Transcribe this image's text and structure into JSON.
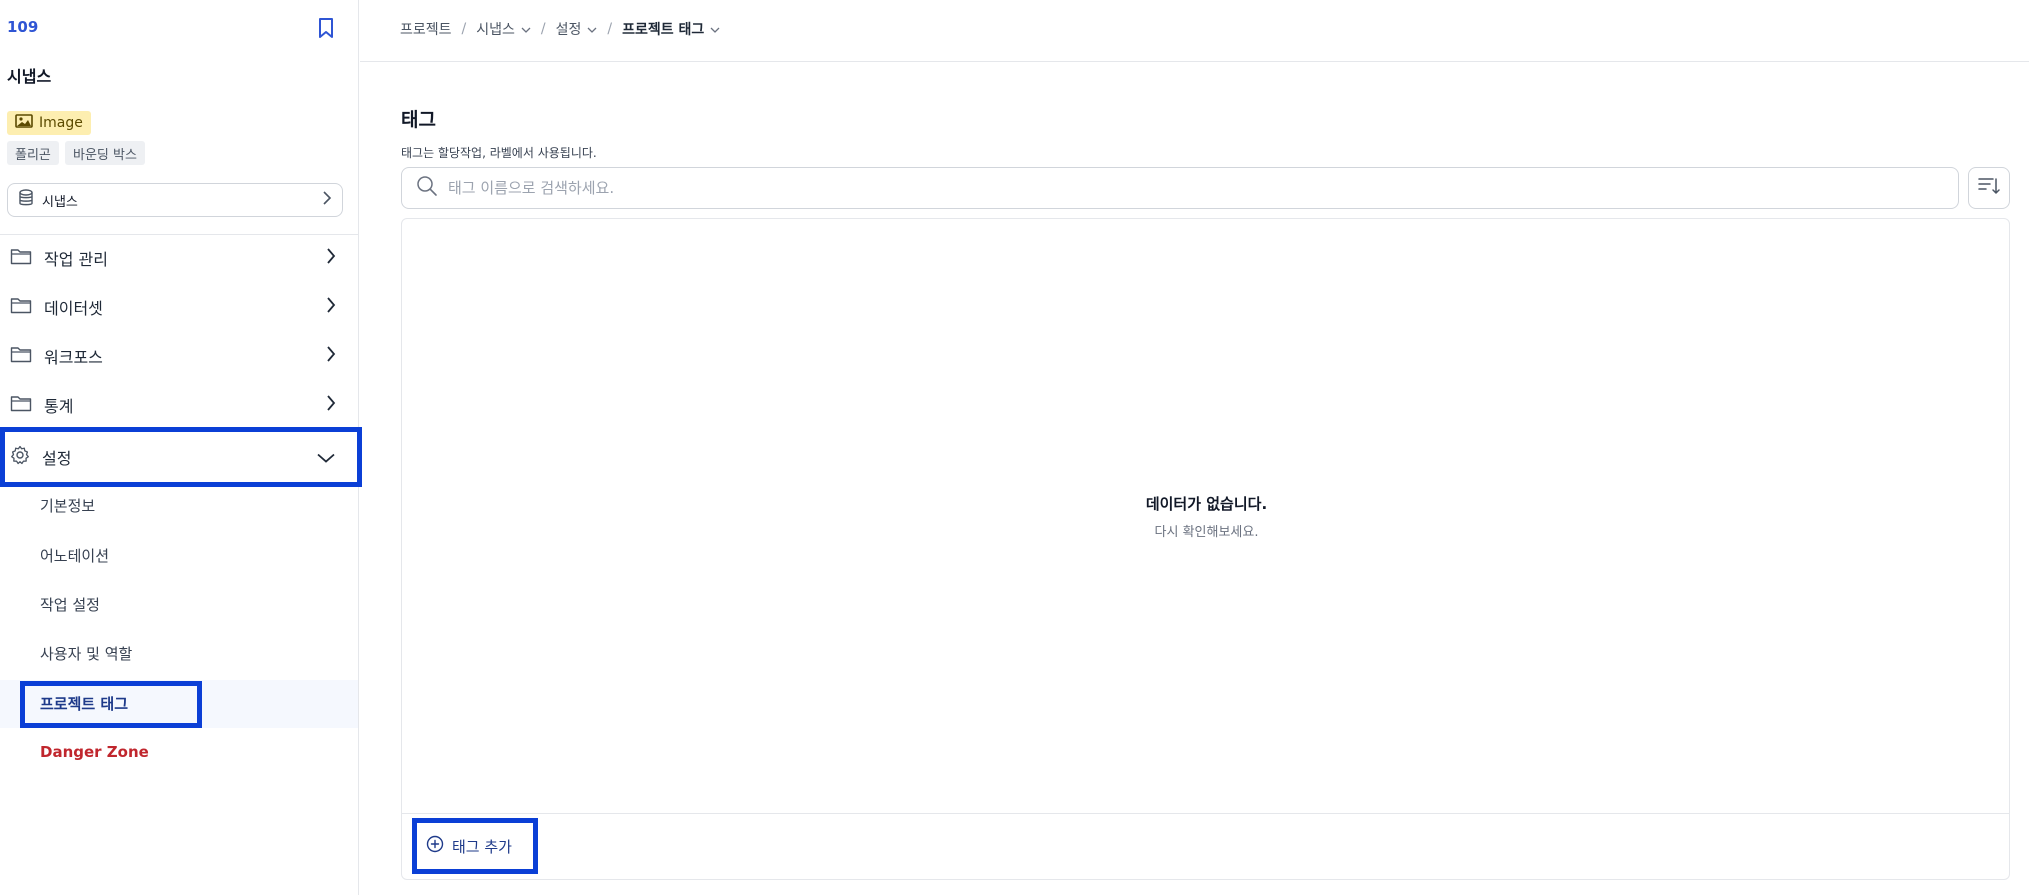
{
  "sidebar": {
    "project_id": "109",
    "project_name": "시냅스",
    "badge_image": "Image",
    "chips": [
      "폴리곤",
      "바운딩 박스"
    ],
    "dataset_label": "시냅스",
    "nav": [
      {
        "label": "작업 관리"
      },
      {
        "label": "데이터셋"
      },
      {
        "label": "워크포스"
      },
      {
        "label": "통계"
      },
      {
        "label": "설정"
      }
    ],
    "settings_sub": [
      {
        "label": "기본정보"
      },
      {
        "label": "어노테이션"
      },
      {
        "label": "작업 설정"
      },
      {
        "label": "사용자 및 역할"
      },
      {
        "label": "프로젝트 태그"
      },
      {
        "label": "Danger Zone"
      }
    ]
  },
  "breadcrumb": [
    "프로젝트",
    "시냅스",
    "설정",
    "프로젝트 태그"
  ],
  "main": {
    "title": "태그",
    "description": "태그는 할당작업, 라벨에서 사용됩니다.",
    "search_placeholder": "태그 이름으로 검색하세요.",
    "empty_title": "데이터가 없습니다.",
    "empty_subtitle": "다시 확인해보세요.",
    "add_tag_label": "태그 추가"
  },
  "colors": {
    "accent": "#2f55d4",
    "highlight_box": "#0b3fd6",
    "danger": "#c0262d",
    "badge_bg": "#fdeeb0"
  }
}
